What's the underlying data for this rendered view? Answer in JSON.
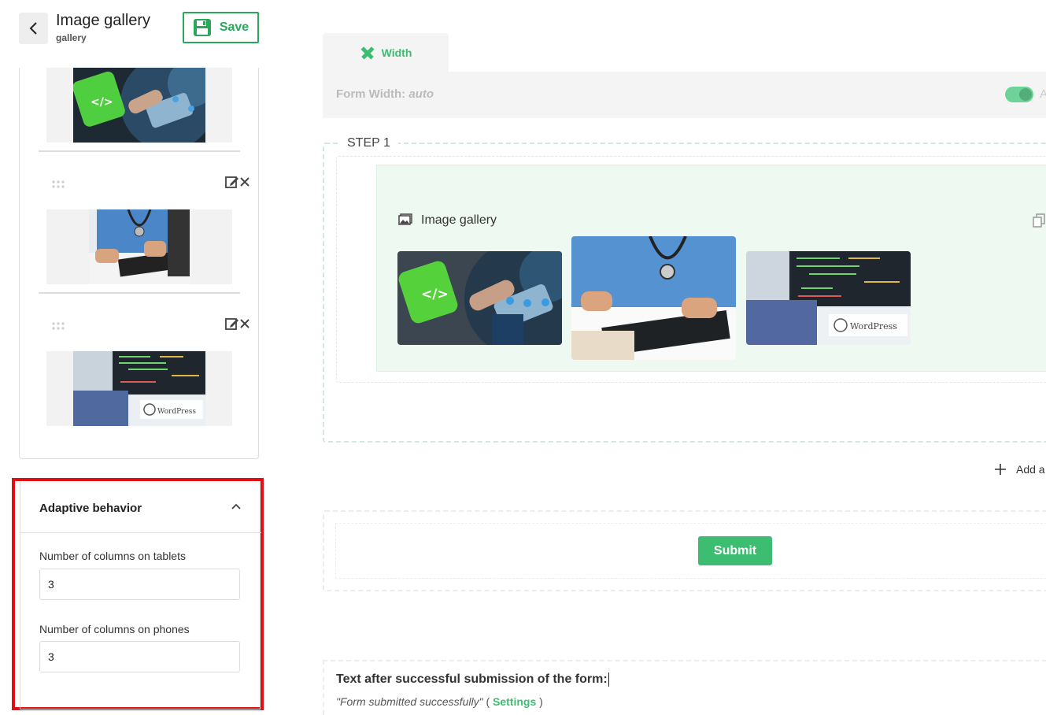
{
  "header": {
    "title": "Image gallery",
    "subtitle": "gallery",
    "save_label": "Save"
  },
  "adaptive": {
    "title": "Adaptive behavior",
    "tablets_label": "Number of columns on tablets",
    "tablets_value": "3",
    "phones_label": "Number of columns on phones",
    "phones_value": "3"
  },
  "canvas": {
    "tab_label": "Width",
    "form_width_label": "Form Width:",
    "form_width_value": "auto",
    "toggle_letter": "A",
    "step_label": "STEP 1",
    "gallery_title": "Image gallery",
    "add_label": "Add a",
    "submit_label": "Submit",
    "after_title": "Text after successful submission of the form:",
    "after_message": "\"Form submitted successfully\"",
    "after_open": "(",
    "after_link": "Settings",
    "after_close": ")"
  },
  "images": {
    "wordpress_text": "WordPress"
  },
  "colors": {
    "accent": "#3cbd72",
    "highlight_border": "#e30e13"
  }
}
